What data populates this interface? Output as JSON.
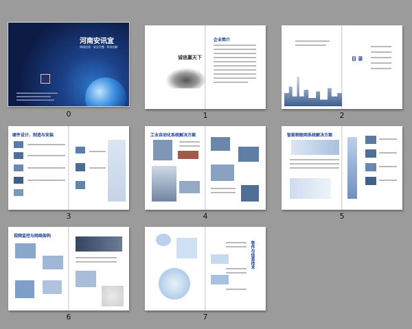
{
  "slides": [
    {
      "number": "0",
      "title": "河南安讯宜",
      "subtitle": "网络信息 · 安全可靠 · 科技创新"
    },
    {
      "number": "1",
      "title": "诚信赢天下",
      "heading": "企业简介"
    },
    {
      "number": "2",
      "title": "目 录"
    },
    {
      "number": "3",
      "title": "硬件设计、制造与安装"
    },
    {
      "number": "4",
      "title": "工业自动化系统解决方案"
    },
    {
      "number": "5",
      "title": "智能物联网系统解决方案"
    },
    {
      "number": "6",
      "title": "视频监控与网络架构"
    },
    {
      "number": "7",
      "title": "软件与信息技术"
    }
  ],
  "colors": {
    "background": "#9b9b9b",
    "cover_dark": "#0d1c45",
    "accent_blue": "#1b3d9a"
  }
}
